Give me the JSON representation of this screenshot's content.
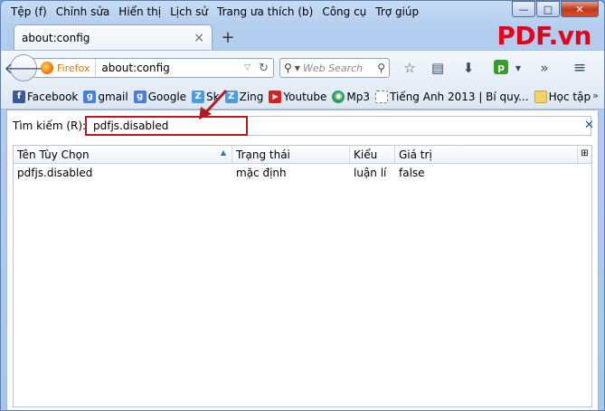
{
  "menu": [
    {
      "label": "Tệp (f)"
    },
    {
      "label": "Chỉnh sửa"
    },
    {
      "label": "Hiển thị"
    },
    {
      "label": "Lịch sử"
    },
    {
      "label": "Trang ưa thích (b)"
    },
    {
      "label": "Công cụ"
    },
    {
      "label": "Trợ giúp"
    }
  ],
  "window_controls": {
    "minimize": "—",
    "maximize": "□",
    "close": "✕"
  },
  "tab": {
    "title": "about:config",
    "close": "×",
    "new_tab": "+"
  },
  "logo": "PDF.vn",
  "nav": {
    "identity_label": "Firefox",
    "url": "about:config",
    "search_placeholder": "Web Search"
  },
  "bookmarks": [
    {
      "label": "Facebook",
      "icon": "facebook-icon",
      "color": "#3b5998",
      "glyph": "f"
    },
    {
      "label": "gmail",
      "icon": "google-icon",
      "color": "#4a7fd8",
      "glyph": "g"
    },
    {
      "label": "Google",
      "icon": "google-icon",
      "color": "#4a7fd8",
      "glyph": "g"
    },
    {
      "label": "Sk",
      "icon": "zing-icon",
      "color": "#4a9be0",
      "glyph": "Z"
    },
    {
      "label": "Zing",
      "icon": "zing-icon",
      "color": "#4a9be0",
      "glyph": "Z"
    },
    {
      "label": "Youtube",
      "icon": "youtube-icon",
      "color": "#d22222",
      "glyph": "▶"
    },
    {
      "label": "Mp3",
      "icon": "mp3-icon",
      "color": "#2ca05a",
      "glyph": "◉"
    },
    {
      "label": "Tiếng Anh 2013 | Bí quy...",
      "icon": "page-icon",
      "color": "#ffffff",
      "glyph": ""
    },
    {
      "label": "Học tập",
      "icon": "folder-icon",
      "color": "#f2d36a",
      "glyph": ""
    }
  ],
  "bookmarks_more": "»",
  "config": {
    "filter_label": "Tìm kiếm (R):",
    "filter_value": "pdfjs.disabled",
    "columns": [
      "Tên Tùy Chọn",
      "Trạng thái",
      "Kiểu",
      "Giá trị"
    ],
    "rows": [
      {
        "name": "pdfjs.disabled",
        "status": "mặc định",
        "type": "luận lí",
        "value": "false"
      }
    ]
  },
  "colors": {
    "annotation": "#b01b22",
    "logo": "#e3001b"
  }
}
